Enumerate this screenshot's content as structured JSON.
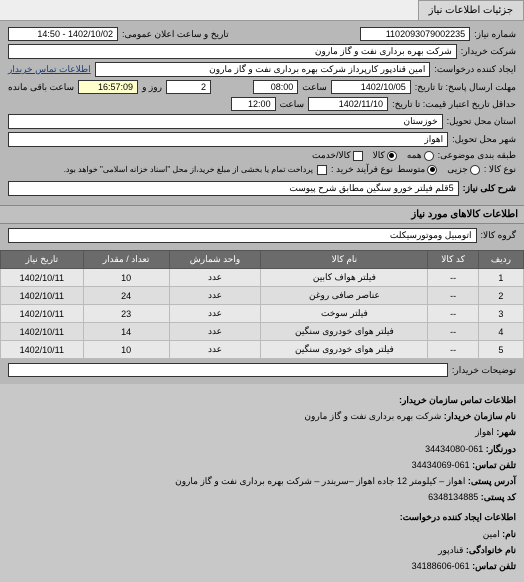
{
  "tab": {
    "title": "جزئیات اطلاعات نیاز"
  },
  "form": {
    "req_no_label": "شماره نیاز:",
    "req_no": "1102093079002235",
    "announce_label": "تاریخ و ساعت اعلان عمومی:",
    "announce_val": "1402/10/02 - 14:50",
    "buyer_label": "شرکت خریدار:",
    "buyer_val": "شرکت بهره برداری نفت و گاز مارون",
    "creator_label": "ایجاد کننده درخواست:",
    "creator_val": "امین قنادپور کارپرداز شرکت بهره برداری نفت و گاز مارون",
    "contact_link": "اطلاعات تماس خریدار",
    "deadline_from_label": "مهلت ارسال پاسخ: تا تاریخ:",
    "deadline_date": "1402/10/05",
    "time_label": "ساعت",
    "deadline_time": "08:00",
    "day_label": "روز و",
    "days_remain": "2",
    "remain_time": "16:57:09",
    "remain_label": "ساعت باقی مانده",
    "validity_label": "حداقل تاریخ اعتبار قیمت: تا تاریخ:",
    "validity_date": "1402/11/10",
    "validity_time": "12:00",
    "province_label": "استان محل تحویل:",
    "province_val": "خوزستان",
    "city_label": "شهر محل تحویل:",
    "city_val": "اهواز",
    "subject_type_label": "طبقه بندی موضوعی:",
    "kind_label": "نوع کالا :",
    "radio_all": "همه",
    "radio_goods": "کالا",
    "radio_service": "کالا/خدمت",
    "radio_small": "جزیی",
    "radio_medium": "متوسط",
    "buy_process_label": "نوع فرآیند خرید :",
    "buy_process_note": "پرداخت تمام یا بخشی از مبلغ خرید،از محل \"اسناد خزانه اسلامی\" خواهد بود.",
    "desc_label": "شرح کلی نیاز:",
    "desc_val": "5قلم فیلتر خورو سنگین مطابق شرح پیوست"
  },
  "goods": {
    "section_title": "اطلاعات کالاهای مورد نیاز",
    "group_label": "گروه کالا:",
    "group_val": "اتومبیل وموتورسیکلت",
    "cols": {
      "row": "ردیف",
      "code": "کد کالا",
      "name": "نام کالا",
      "unit": "واحد شمارش",
      "qty": "تعداد / مقدار",
      "date": "تاریخ نیاز"
    },
    "rows": [
      {
        "n": "1",
        "code": "--",
        "name": "فیلتر هواف کابین",
        "unit": "عدد",
        "qty": "10",
        "date": "1402/10/11"
      },
      {
        "n": "2",
        "code": "--",
        "name": "عناصر صافی روغن",
        "unit": "عدد",
        "qty": "24",
        "date": "1402/10/11"
      },
      {
        "n": "3",
        "code": "--",
        "name": "فیلتر سوخت",
        "unit": "عدد",
        "qty": "23",
        "date": "1402/10/11"
      },
      {
        "n": "4",
        "code": "--",
        "name": "فیلتر هوای خودروی سنگین",
        "unit": "عدد",
        "qty": "14",
        "date": "1402/10/11"
      },
      {
        "n": "5",
        "code": "--",
        "name": "فیلتر هوای خودروی سنگین",
        "unit": "عدد",
        "qty": "10",
        "date": "1402/10/11"
      }
    ],
    "comments_label": "توضیحات خریدار:"
  },
  "contact": {
    "head": "اطلاعات تماس سازمان خریدار:",
    "org_label": "نام سازمان خریدار:",
    "org_val": "شرکت بهره برداری نفت و گاز مارون",
    "city_label": "شهر:",
    "city_val": "اهواز",
    "fax_label": "دورنگار:",
    "fax_val": "061-34434080",
    "phone_label": "تلفن تماس:",
    "phone_val": "061-34434069",
    "addr_label": "آدرس پستی:",
    "addr_val": "اهواز – کیلومتر 12 جاده اهواز –سربندر – شرکت بهره برداری نفت و گاز مارون",
    "zip_label": "کد پستی:",
    "zip_val": "6348134885",
    "creator_head": "اطلاعات ایجاد کننده درخواست:",
    "fname_label": "نام:",
    "fname_val": "امین",
    "lname_label": "نام خانوادگی:",
    "lname_val": "قنادپور",
    "cphone_label": "تلفن تماس:",
    "cphone_val": "061-34188606"
  }
}
